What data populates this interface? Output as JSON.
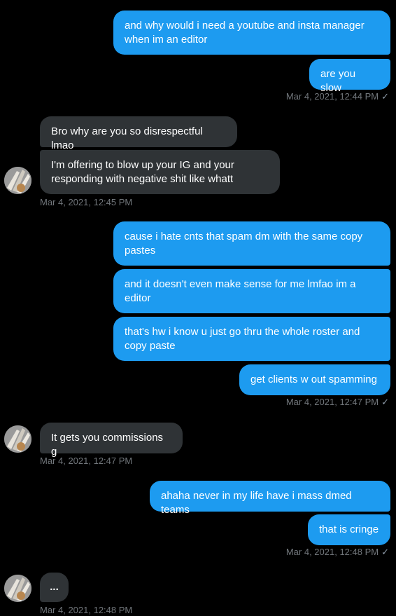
{
  "colors": {
    "background": "#000000",
    "outgoing_bubble": "#1d9bf0",
    "incoming_bubble": "#2f3336",
    "timestamp": "#71767b"
  },
  "messages": [
    {
      "dir": "out",
      "text": "and why would i need a youtube and insta manager when im an editor"
    },
    {
      "dir": "out",
      "text": "are you slow"
    },
    {
      "dir": "out_stamp",
      "text": "Mar 4, 2021, 12:44 PM"
    },
    {
      "dir": "in",
      "text": "Bro why are you so disrespectful lmao"
    },
    {
      "dir": "in",
      "text": "I'm offering to blow up your IG and your responding with negative shit like whatt"
    },
    {
      "dir": "in_stamp",
      "text": "Mar 4, 2021, 12:45 PM"
    },
    {
      "dir": "out",
      "text": "cause i hate cnts that spam dm with the same copy pastes"
    },
    {
      "dir": "out",
      "text": "and it doesn't even make sense for me lmfao im a editor"
    },
    {
      "dir": "out",
      "text": "that's hw i know u just go thru the whole roster and copy paste"
    },
    {
      "dir": "out",
      "text": "get clients w out spamming"
    },
    {
      "dir": "out_stamp",
      "text": "Mar 4, 2021, 12:47 PM"
    },
    {
      "dir": "in",
      "text": "It gets you commissions g"
    },
    {
      "dir": "in_stamp",
      "text": "Mar 4, 2021, 12:47 PM"
    },
    {
      "dir": "out",
      "text": "ahaha never in my life have i mass dmed teams"
    },
    {
      "dir": "out",
      "text": "that is cringe"
    },
    {
      "dir": "out_stamp",
      "text": "Mar 4, 2021, 12:48 PM"
    },
    {
      "dir": "in",
      "text": "..."
    },
    {
      "dir": "in_stamp",
      "text": "Mar 4, 2021, 12:48 PM"
    }
  ],
  "icons": {
    "read_receipt": "check-icon",
    "avatar": "user-avatar"
  }
}
